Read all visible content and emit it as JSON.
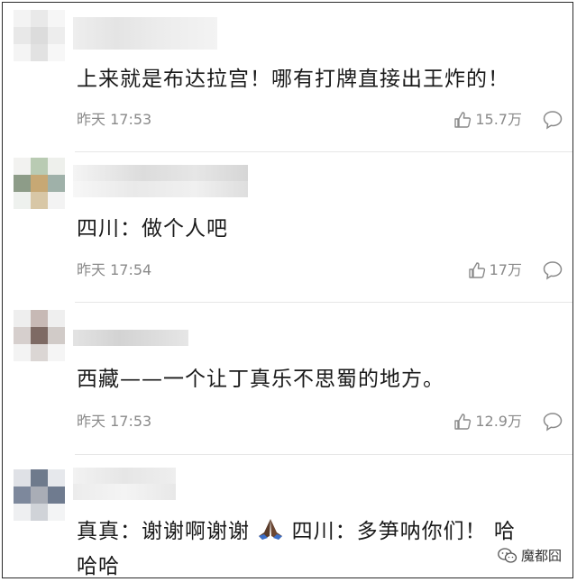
{
  "comments": [
    {
      "text": "上来就是布达拉宫！哪有打牌直接出王炸的！",
      "time": "昨天 17:53",
      "likes": "15.7万"
    },
    {
      "text": "四川：做个人吧",
      "time": "昨天 17:54",
      "likes": "17万"
    },
    {
      "text": "西藏——一个让丁真乐不思蜀的地方。",
      "time": "昨天 17:53",
      "likes": "12.9万"
    },
    {
      "text_line1_a": "真真：谢谢啊谢谢",
      "text_line1_b": "四川：多笋呐你们！ 哈",
      "text_line2": "哈哈"
    }
  ],
  "icons": {
    "like": "thumbs-up-icon",
    "reply": "comment-bubble-icon",
    "emoji": "folded-hands-emoji",
    "watermark": "wechat-logo-icon"
  },
  "watermark": {
    "text": "魔都囧"
  },
  "colors": {
    "text": "#1a1a1a",
    "meta": "#8a8a8a",
    "divider": "#e6e6e6"
  }
}
